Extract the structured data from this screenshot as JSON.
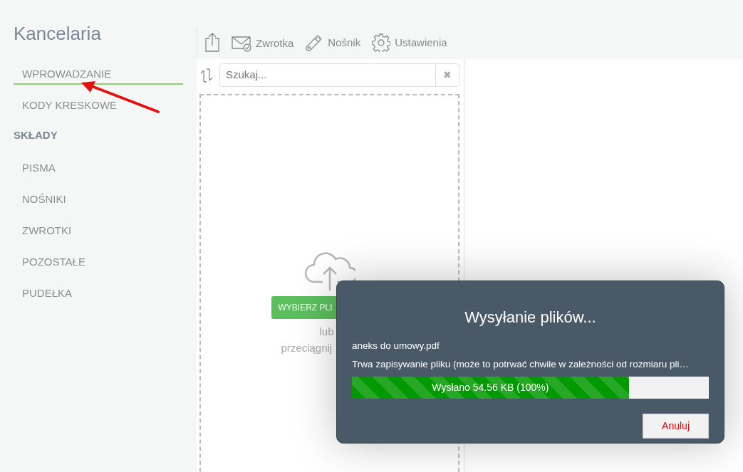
{
  "app": {
    "title": "Kancelaria"
  },
  "sidebar": {
    "items": [
      {
        "kind": "link",
        "label": "WPROWADZANIE",
        "selected": true
      },
      {
        "kind": "link",
        "label": "KODY KRESKOWE",
        "selected": false
      },
      {
        "kind": "header",
        "label": "SKŁADY"
      },
      {
        "kind": "link",
        "label": "PISMA",
        "selected": false
      },
      {
        "kind": "link",
        "label": "NOŚNIKI",
        "selected": false
      },
      {
        "kind": "link",
        "label": "ZWROTKI",
        "selected": false
      },
      {
        "kind": "link",
        "label": "POZOSTAŁE",
        "selected": false
      },
      {
        "kind": "link",
        "label": "PUDEŁKA",
        "selected": false
      }
    ]
  },
  "toolbar": {
    "items": [
      {
        "kind": "export"
      },
      {
        "kind": "mail",
        "label": "Zwrotka"
      },
      {
        "kind": "usb",
        "label": "Nośnik"
      },
      {
        "kind": "gear",
        "label": "Ustawienia"
      }
    ]
  },
  "search": {
    "placeholder": "Szukaj...",
    "clear": "✖"
  },
  "dropzone": {
    "button": "WYBIERZ PLI",
    "or": "lub",
    "hint": "przeciągnij"
  },
  "upload_dialog": {
    "title": "Wysyłanie plików...",
    "file": "aneks do umowy.pdf",
    "message": "Trwa zapisywanie pliku (może to potrwać chwile w zależności od rozmiaru pli…",
    "progress": {
      "level": 0.776,
      "reading": "Wysłano  54.56 KB  (100%)"
    },
    "cancel": "Anuluj"
  }
}
